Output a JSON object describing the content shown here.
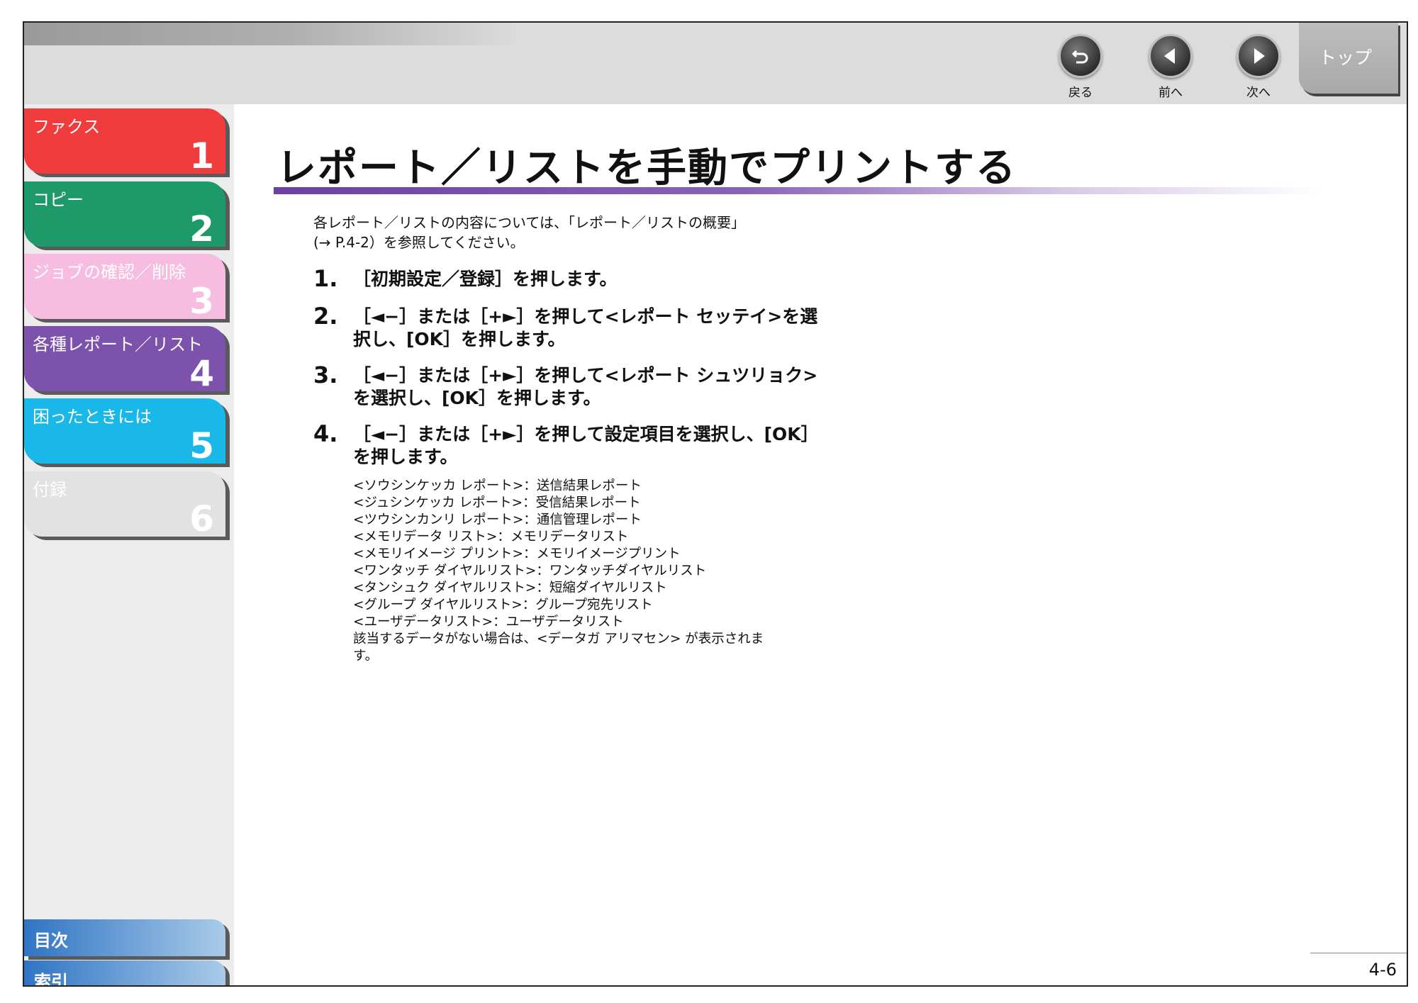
{
  "nav": {
    "back_label": "戻る",
    "prev_label": "前へ",
    "next_label": "次へ",
    "top_label": "トップ"
  },
  "sidebar": {
    "chapters": [
      {
        "title": "ファクス",
        "number": "1"
      },
      {
        "title": "コピー",
        "number": "2"
      },
      {
        "title": "ジョブの確認／削除",
        "number": "3"
      },
      {
        "title": "各種レポート／リスト",
        "number": "4"
      },
      {
        "title": "困ったときには",
        "number": "5"
      },
      {
        "title": "付録",
        "number": "6"
      }
    ],
    "contents_label": "目次",
    "index_label": "索引"
  },
  "main": {
    "title": "レポート／リストを手動でプリントする",
    "intro_line1": "各レポート／リストの内容については、「レポート／リストの概要」",
    "intro_line2": "(→ P.4-2）を参照してください。",
    "steps": [
      {
        "num": "1.",
        "text": "［初期設定／登録］を押します。"
      },
      {
        "num": "2.",
        "text": "［◄−］または［+►］を押して<レポート セッテイ>を選択し、[OK］を押します。"
      },
      {
        "num": "3.",
        "text": "［◄−］または［+►］を押して<レポート シュツリョク>を選択し、[OK］を押します。"
      },
      {
        "num": "4.",
        "text": "［◄−］または［+►］を押して設定項目を選択し、[OK］を押します。"
      }
    ],
    "options": [
      "<ソウシンケッカ レポート>：送信結果レポート",
      "<ジュシンケッカ レポート>：受信結果レポート",
      "<ツウシンカンリ レポート>：通信管理レポート",
      "<メモリデータ リスト>：メモリデータリスト",
      "<メモリイメージ プリント>：メモリイメージプリント",
      "<ワンタッチ ダイヤルリスト>：ワンタッチダイヤルリスト",
      "<タンシュク ダイヤルリスト>：短縮ダイヤルリスト",
      "<グループ ダイヤルリスト>：グループ宛先リスト",
      "<ユーザデータリスト>：ユーザデータリスト"
    ],
    "note_line1": "該当するデータがない場合は、<データガ アリマセン> が表示されま",
    "note_line2": "す。"
  },
  "page_number": "4-6",
  "colors": {
    "chapter1": "#f03c3c",
    "chapter2": "#1e9a6a",
    "chapter3": "#f7bde0",
    "chapter4": "#7c52ad",
    "chapter5": "#1ab8e8",
    "chapter6": "#e2e2e2",
    "title_rule": "#6e3fa3"
  }
}
